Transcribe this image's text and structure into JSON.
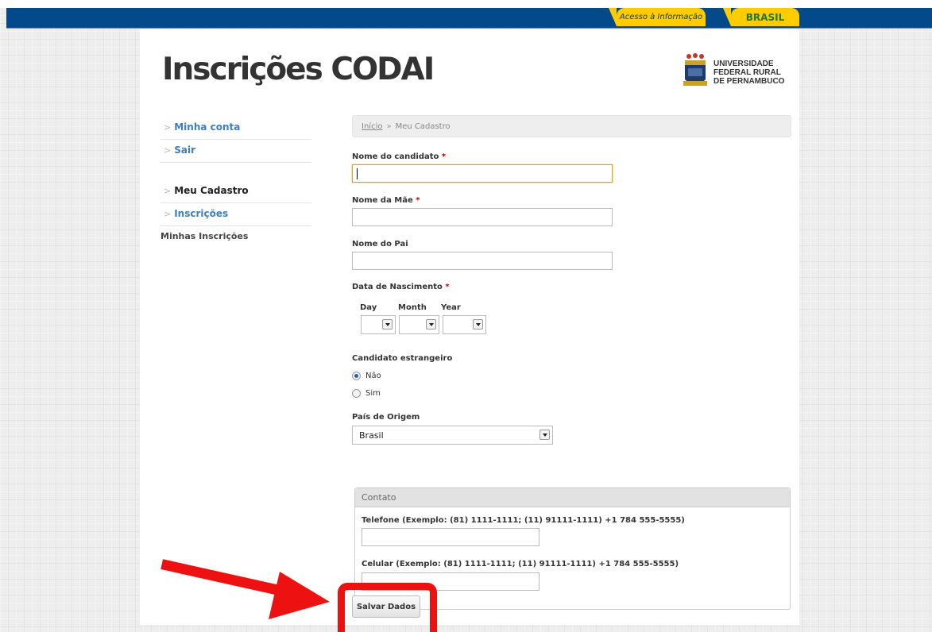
{
  "gov_bar": {
    "acesso_label": "Acesso à Informação",
    "brasil_label": "BRASIL"
  },
  "header": {
    "title": "Inscrições CODAI",
    "logo_lines": [
      "UNIVERSIDADE",
      "FEDERAL RURAL",
      "DE PERNAMBUCO"
    ]
  },
  "sidebar": {
    "items": [
      {
        "label": "Minha conta"
      },
      {
        "label": "Sair"
      },
      {
        "label": "Meu Cadastro"
      },
      {
        "label": "Inscrições"
      }
    ],
    "sub_item": "Minhas Inscrições"
  },
  "breadcrumb": {
    "home": "Início",
    "separator": "»",
    "current": "Meu Cadastro"
  },
  "form": {
    "nome_candidato_label": "Nome do candidato",
    "nome_mae_label": "Nome da Mãe",
    "nome_pai_label": "Nome do Pai",
    "data_nascimento_label": "Data de Nascimento",
    "required_mark": "*",
    "day_label": "Day",
    "month_label": "Month",
    "year_label": "Year",
    "estrangeiro_label": "Candidato estrangeiro",
    "estrangeiro_options": [
      "Não",
      "Sim"
    ],
    "estrangeiro_selected": "Não",
    "pais_label": "País de Origem",
    "pais_value": "Brasil",
    "contato_legend": "Contato",
    "telefone_label": "Telefone (Exemplo: (81) 1111-1111; (11) 91111-1111) +1 784 555-5555)",
    "celular_label": "Celular (Exemplo: (81) 1111-1111; (11) 91111-1111) +1 784 555-5555)",
    "save_label": "Salvar Dados"
  },
  "annotation": {
    "color": "#ee1111"
  }
}
